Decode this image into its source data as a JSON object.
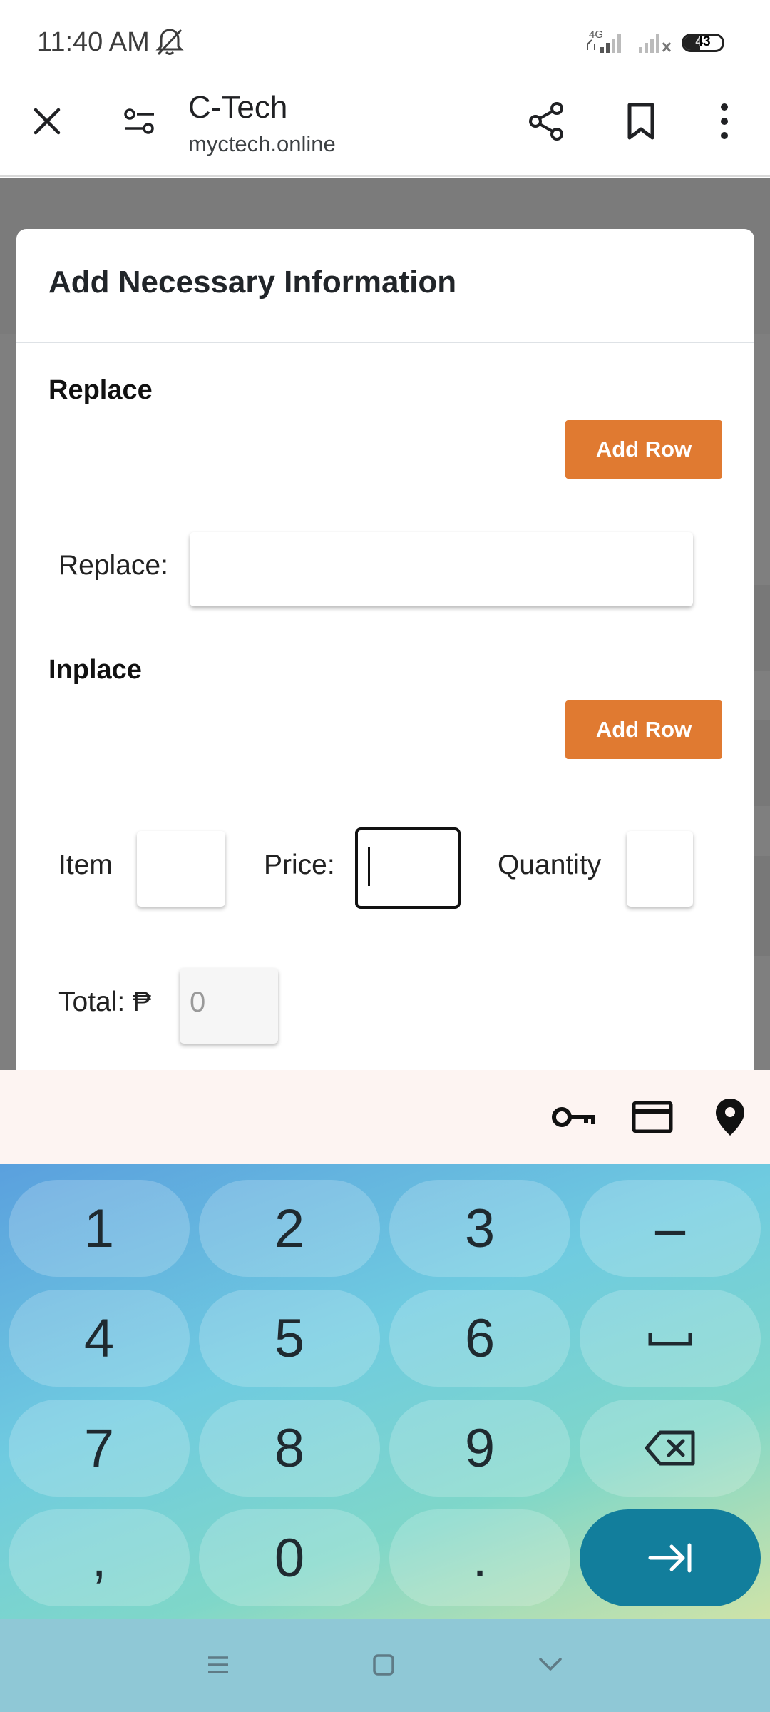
{
  "status_bar": {
    "time": "11:40 AM",
    "network_label": "4G",
    "battery": "43",
    "icons": [
      "bell-off-icon",
      "signal-icon",
      "signal-off-icon",
      "battery-icon"
    ]
  },
  "browser": {
    "title": "C-Tech",
    "url": "myctech.online",
    "icons": [
      "close-icon",
      "site-settings-icon",
      "share-icon",
      "bookmark-icon",
      "more-icon"
    ]
  },
  "modal": {
    "title": "Add Necessary Information",
    "replace_section": {
      "heading": "Replace",
      "add_row_label": "Add Row",
      "field_label": "Replace:",
      "field_value": ""
    },
    "inplace_section": {
      "heading": "Inplace",
      "add_row_label": "Add Row",
      "item_label": "Item",
      "item_value": "",
      "price_label": "Price:",
      "price_value": "",
      "quantity_label": "Quantity",
      "quantity_value": ""
    },
    "total": {
      "label": "Total: ₱",
      "value": "0"
    }
  },
  "autofill_bar": {
    "icons": [
      "key-icon",
      "credit-card-icon",
      "location-pin-icon"
    ]
  },
  "keyboard": {
    "rows": [
      [
        "1",
        "2",
        "3",
        "–"
      ],
      [
        "4",
        "5",
        "6",
        "␣"
      ],
      [
        "7",
        "8",
        "9",
        "⌫"
      ],
      [
        ",",
        "0",
        ".",
        "⇥"
      ]
    ]
  },
  "nav_bar": {
    "icons": [
      "menu-icon",
      "home-icon",
      "back-icon"
    ]
  },
  "colors": {
    "accent_button": "#e07a31",
    "enter_key": "#127e9c",
    "overlay": "rgba(0,0,0,0.5)"
  }
}
